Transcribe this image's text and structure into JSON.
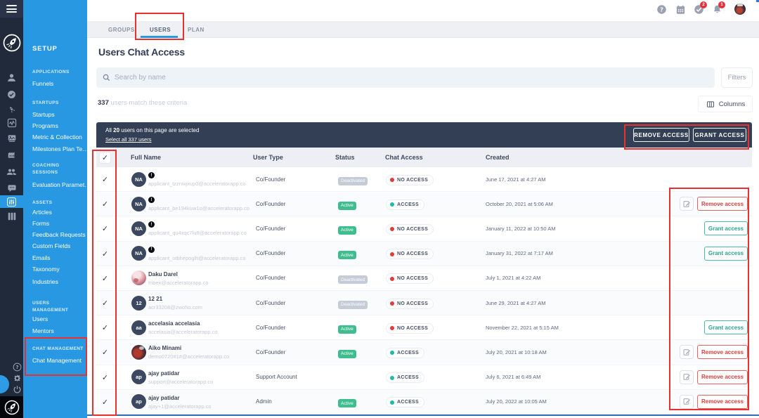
{
  "app": {
    "accent_blue": "#2898e2",
    "annotation_red": "#e8312f",
    "banner_dark": "#333f54"
  },
  "topbar": {
    "icons": [
      "help-icon",
      "calendar-icon",
      "tasks-icon",
      "notifications-icon",
      "avatar"
    ],
    "tasks_badge": "2",
    "notifications_badge": "1"
  },
  "rail": {
    "icons": [
      "menu-icon",
      "logo-rocket-icon",
      "person-icon",
      "check-circle-icon",
      "launch-icon",
      "metrics-icon",
      "media-icon",
      "building-icon",
      "people-icon",
      "chat-bubble-icon",
      "sliders-icon",
      "columns-board-icon",
      "help-outline-icon",
      "gear-icon",
      "power-icon",
      "chat-launcher-icon",
      "logo-rocket-icon"
    ],
    "active_icon": "sliders-icon"
  },
  "sidebar": {
    "title": "SETUP",
    "sections": [
      {
        "header": "APPLICATIONS",
        "items": [
          "Funnels"
        ]
      },
      {
        "header": "STARTUPS",
        "items": [
          "Startups",
          "Programs",
          "Metric & Collection",
          "Milestones Plan Te…"
        ]
      },
      {
        "header": "COACHING SESSIONS",
        "items": [
          "Evaluation Paramet…"
        ]
      },
      {
        "header": "ASSETS",
        "items": [
          "Articles",
          "Forms",
          "Feedback Requests",
          "Custom Fields",
          "Emails",
          "Taxonomy",
          "Industries"
        ]
      },
      {
        "header": "USERS MANAGEMENT",
        "items": [
          "Users",
          "Mentors"
        ]
      },
      {
        "header": "CHAT MANAGEMENT",
        "items": [
          "Chat Management"
        ]
      }
    ]
  },
  "tabs": [
    {
      "label": "GROUPS",
      "active": false
    },
    {
      "label": "USERS",
      "active": true
    },
    {
      "label": "PLAN",
      "active": false
    }
  ],
  "page": {
    "title": "Users Chat Access"
  },
  "search": {
    "placeholder": "Search by name",
    "filters_label": "Filters"
  },
  "results": {
    "count": "337",
    "suffix": "users match these criteria",
    "columns_label": "Columns"
  },
  "selection_banner": {
    "prefix": "All",
    "count": "20",
    "suffix": "users on this page are selected",
    "select_all": "Select all 337 users",
    "remove_label": "REMOVE ACCESS",
    "grant_label": "GRANT ACCESS"
  },
  "table": {
    "headers": [
      "Full Name",
      "User Type",
      "Status",
      "Chat Access",
      "Created"
    ],
    "action_remove": "Remove access",
    "action_grant": "Grant access",
    "rows": [
      {
        "initials": "NA",
        "name": "",
        "email": "applicant_tzznwjxup0@acceleratorapp.co",
        "type": "Co/Founder",
        "status": "Deactivated",
        "access": "NO ACCESS",
        "created": "June 17, 2021 at 4:27 AM"
      },
      {
        "initials": "NA",
        "name": "",
        "email": "applicant_be194kuw1o@acceleratorapp.co",
        "type": "Co/Founder",
        "status": "Active",
        "access": "ACCESS",
        "created": "October 20, 2021 at 5:06 AM"
      },
      {
        "initials": "NA",
        "name": "",
        "email": "applicant_qu4xqc7lu8@acceleratorapp.co",
        "type": "Co/Founder",
        "status": "Active",
        "access": "NO ACCESS",
        "created": "January 11, 2022 at 10:50 AM"
      },
      {
        "initials": "NA",
        "name": "",
        "email": "applicant_otbhepoglh@acceleratorapp.co",
        "type": "Co/Founder",
        "status": "Active",
        "access": "NO ACCESS",
        "created": "January 31, 2022 at 7:17 AM"
      },
      {
        "initials": "",
        "name": "Daku Darel",
        "email": "tribex@acceleratorapp.co",
        "type": "Co/Founder",
        "status": "Deactivated",
        "access": "NO ACCESS",
        "created": "July 1, 2021 at 4:22 AM"
      },
      {
        "initials": "12",
        "name": "12 21",
        "email": "acr33208@zwoho.com",
        "type": "Co/Founder",
        "status": "Deactivated",
        "access": "NO ACCESS",
        "created": "June 29, 2021 at 4:27 AM"
      },
      {
        "initials": "aa",
        "name": "accelasia accelasia",
        "email": "accelasia@acceleratorapp.co",
        "type": "Co/Founder",
        "status": "Active",
        "access": "NO ACCESS",
        "created": "November 22, 2021 at 5:15 AM"
      },
      {
        "initials": "",
        "name": "Aiko Minami",
        "email": "demo0720#1#@acceleratorapp.co",
        "type": "Co/Founder",
        "status": "Active",
        "access": "ACCESS",
        "created": "July 20, 2021 at 10:18 AM"
      },
      {
        "initials": "ap",
        "name": "ajay patidar",
        "email": "support@acceleratorapp.co",
        "type": "Support Account",
        "status": "",
        "access": "ACCESS",
        "created": "July 6, 2021 at 6:49 AM"
      },
      {
        "initials": "ap",
        "name": "ajay patidar",
        "email": "ajay+1@acceleratorapp.co",
        "type": "Admin",
        "status": "Active",
        "access": "ACCESS",
        "created": "July 20, 2022 at 10:05 AM"
      }
    ]
  }
}
